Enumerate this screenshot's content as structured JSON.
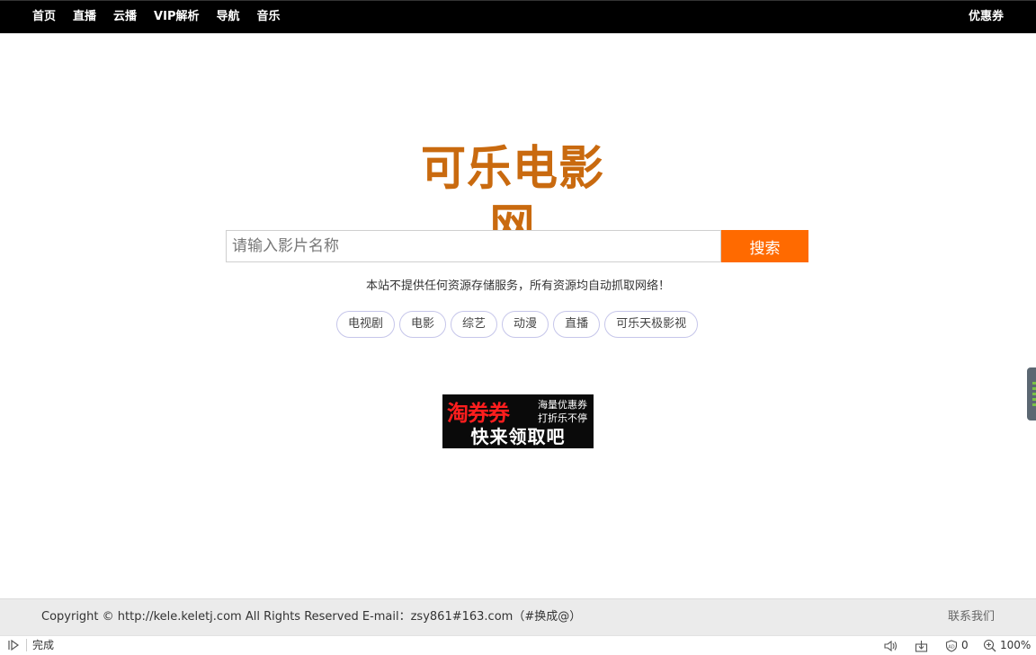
{
  "nav": {
    "items": [
      "首页",
      "直播",
      "云播",
      "VIP解析",
      "导航",
      "音乐"
    ],
    "right_link": "优惠券"
  },
  "logo": {
    "text": "可乐电影网",
    "color": "#c96a0f"
  },
  "search": {
    "placeholder": "请输入影片名称",
    "value": "",
    "button_label": "搜索",
    "button_color": "#ff6a00"
  },
  "notice": "本站不提供任何资源存储服务，所有资源均自动抓取网络！",
  "tags": [
    "电视剧",
    "电影",
    "综艺",
    "动漫",
    "直播",
    "可乐天极影视"
  ],
  "promo": {
    "headline": "淘券券",
    "line1": "海量优惠券",
    "line2": "打折乐不停",
    "tagline": "快来领取吧"
  },
  "footer": {
    "copyright": "Copyright © http://kele.keletj.com All Rights Reserved E-mail：zsy861#163.com（#换成@）",
    "contact": "联系我们"
  },
  "statusbar": {
    "status": "完成",
    "ad_count": "0",
    "zoom": "100%"
  }
}
